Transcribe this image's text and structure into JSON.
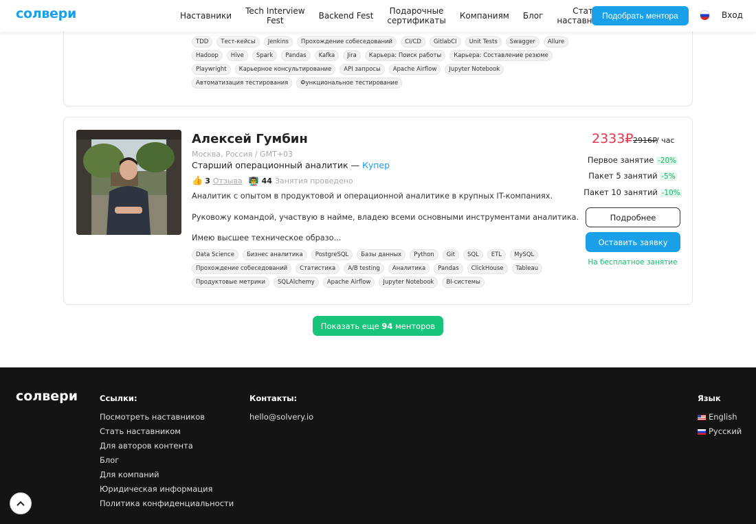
{
  "header": {
    "logo": "солвери",
    "nav": [
      "Наставники",
      "Tech Interview\nFest",
      "Backend Fest",
      "Подарочные\nсертификаты",
      "Компаниям",
      "Блог",
      "Стать\nнаставником"
    ],
    "cta": "Подобрать ментора",
    "login": "Вход"
  },
  "card1": {
    "tag_rows": [
      [
        "TDD",
        "Тест-кейсы",
        "Jenkins",
        "Прохождение собеседований",
        "CI/CD",
        "GitlabCI",
        "Unit Tests",
        "Swagger",
        "Allure"
      ],
      [
        "Hadoop",
        "Hive",
        "Spark",
        "Pandas",
        "Kafka",
        "Jira",
        "Карьера: Поиск работы",
        "Карьера: Составление резюме"
      ],
      [
        "Playwright",
        "Карьерное консультирование",
        "API запросы",
        "Apache Airflow",
        "Jupyter Notebook"
      ],
      [
        "Автоматизация тестирования",
        "Функциональное тестирование"
      ]
    ]
  },
  "card2": {
    "name": "Алексей Гумбин",
    "location": "Москва, Россия / GMT+03",
    "role": "Старший операционный аналитик —",
    "company": "Купер",
    "reviews_count": "3",
    "reviews_label": "Отзыва",
    "sessions_count": "44",
    "sessions_label": "Занятия проведено",
    "desc1": "Аналитик с опытом в продуктовой и операционной аналитике в крупных IT-компаниях.",
    "desc2": "Руковожу командой, участвую в найме, владею всеми основными инструментами аналитика.",
    "desc3": "Имею высшее техническое образо...",
    "price": "2333₽",
    "price_old": "2916₽",
    "price_unit": "/ час",
    "first_label": "Первое занятие",
    "first_pct": "-20%",
    "pack5_label": "Пакет 5 занятий",
    "pack5_pct": "-5%",
    "pack10_label": "Пакет 10 занятий",
    "pack10_pct": "-10%",
    "details_btn": "Подробнее",
    "apply_btn": "Оставить заявку",
    "free_note": "На бесплатное занятие",
    "tags": [
      "Data Science",
      "Бизнес аналитика",
      "PostgreSQL",
      "Базы данных",
      "Python",
      "Git",
      "SQL",
      "ETL",
      "MySQL",
      "Прохождение собеседований",
      "Статистика",
      "A/B testing",
      "Аналитика",
      "Pandas",
      "ClickHouse",
      "Tableau",
      "Продуктовые метрики",
      "SQLAlchemy",
      "Apache Airflow",
      "Jupyter Notebook",
      "BI-системы"
    ]
  },
  "show_more": {
    "prefix": "Показать еще",
    "count": "94",
    "suffix": "менторов"
  },
  "footer": {
    "logo": "солвери",
    "links_title": "Ссылки:",
    "links": [
      "Посмотреть наставников",
      "Стать наставником",
      "Для авторов контента",
      "Блог",
      "Для компаний",
      "Юридическая информация",
      "Политика конфиденциальности"
    ],
    "contacts_title": "Контакты:",
    "email": "hello@solvery.io",
    "lang_title": "Язык",
    "langs": [
      "English",
      "Русский"
    ]
  }
}
